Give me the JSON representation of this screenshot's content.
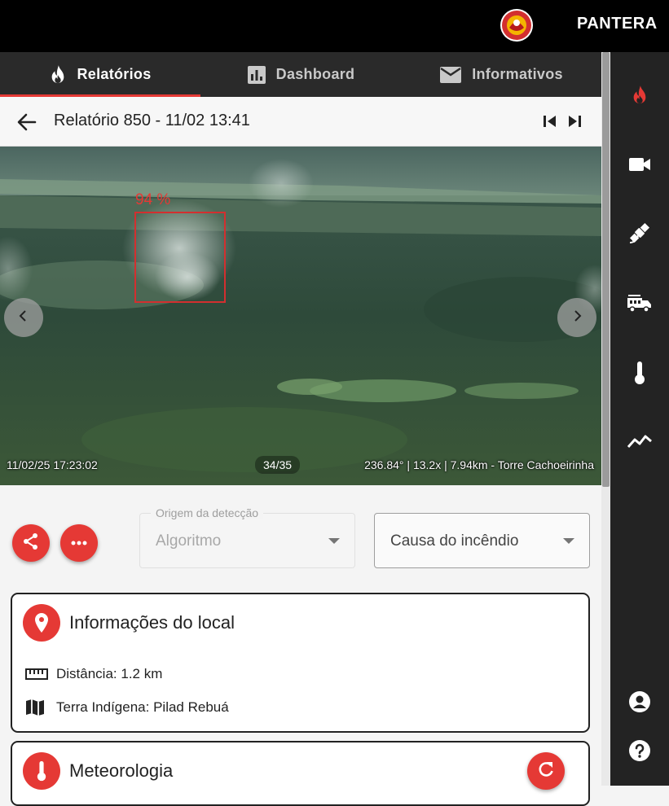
{
  "app": {
    "name": "PANTERA"
  },
  "tabs": [
    {
      "label": "Relatórios",
      "icon": "fire-icon",
      "active": true
    },
    {
      "label": "Dashboard",
      "icon": "bar-chart-icon",
      "active": false
    },
    {
      "label": "Informativos",
      "icon": "mail-icon",
      "active": false
    }
  ],
  "report": {
    "title": "Relatório 850 - 11/02 13:41"
  },
  "photo": {
    "detection_label": "94 %",
    "timestamp": "11/02/25 17:23:02",
    "counter": "34/35",
    "camera_info": "236.84° | 13.2x | 7.94km - Torre Cachoeirinha"
  },
  "fields": {
    "origin": {
      "legend": "Origem da detecção",
      "value": "Algoritmo"
    },
    "cause": {
      "value": "Causa do incêndio"
    }
  },
  "location_card": {
    "title": "Informações do local",
    "distance": "Distância: 1.2 km",
    "territory": "Terra Indígena: Pilad Rebuá"
  },
  "weather_card": {
    "title": "Meteorologia"
  },
  "rail_icons": [
    "fire-icon",
    "camera-icon",
    "satellite-icon",
    "fire-truck-icon",
    "thermometer-icon",
    "line-chart-icon",
    "account-icon",
    "help-icon"
  ],
  "colors": {
    "accent": "#e53935",
    "topbar": "#000000",
    "rail": "#232323",
    "tabs": "#2a2a2a"
  }
}
